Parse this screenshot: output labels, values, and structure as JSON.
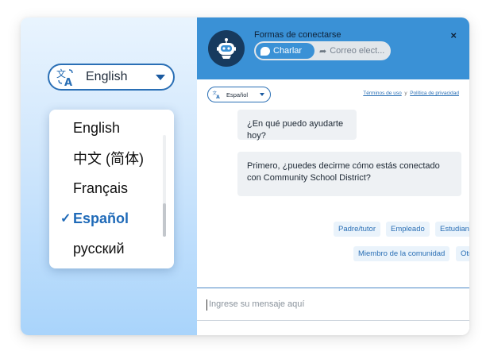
{
  "language_picker": {
    "selected_label": "English",
    "options": [
      {
        "label": "English",
        "selected": false
      },
      {
        "label": "中文 (简体)",
        "selected": false
      },
      {
        "label": "Français",
        "selected": false
      },
      {
        "label": "Español",
        "selected": true
      },
      {
        "label": "русский",
        "selected": false
      }
    ],
    "check_glyph": "✓"
  },
  "chat": {
    "title": "Formas de conectarse",
    "close_glyph": "×",
    "modes": {
      "chat": "Charlar",
      "email": "Correo elect..."
    },
    "language_label": "Español",
    "legal": {
      "terms": "Términos de uso",
      "connector": "y",
      "privacy": "Política de privacidad"
    },
    "messages": [
      "¿En qué puedo ayudarte hoy?",
      "Primero, ¿puedes decirme cómo estás conectado con Community School District?"
    ],
    "quick_replies": [
      "Padre/tutor",
      "Empleado",
      "Estudiante",
      "Miembro de la comunidad",
      "Otra"
    ],
    "input_placeholder": "Ingrese su mensaje aquí"
  },
  "colors": {
    "header": "#3a91d6",
    "accent": "#2a6fb5",
    "avatar": "#173a5e"
  }
}
